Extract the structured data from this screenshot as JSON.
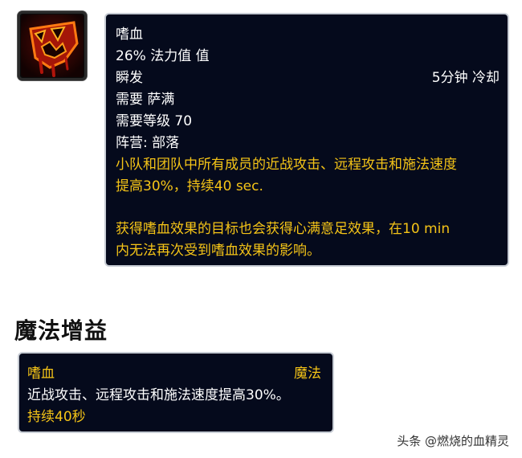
{
  "tooltip": {
    "name": "嗜血",
    "cost": "26% 法力值 值",
    "cast": "瞬发",
    "cooldown": "5分钟 冷却",
    "requires_class": "需要 萨满",
    "requires_level": "需要等级 70",
    "faction": "阵营: 部落",
    "desc1_line1": "小队和团队中所有成员的近战攻击、远程攻击和施法速度",
    "desc1_line2": "提高30%，持续40 sec.",
    "desc2_line1": "获得嗜血效果的目标也会获得心满意足效果，在10 min",
    "desc2_line2": "内无法再次受到嗜血效果的影响。"
  },
  "section": {
    "title": "魔法增益"
  },
  "buff": {
    "name": "嗜血",
    "type": "魔法",
    "desc": "近战攻击、远程攻击和施法速度提高30%。",
    "duration": "持续40秒"
  },
  "watermark": {
    "text": "头条 @燃烧的血精灵"
  },
  "icon": {
    "name": "bloodlust-icon"
  },
  "colors": {
    "tooltip_bg": "#050a1c",
    "text_yellow": "#f5c417",
    "border": "#c7ccd4"
  }
}
